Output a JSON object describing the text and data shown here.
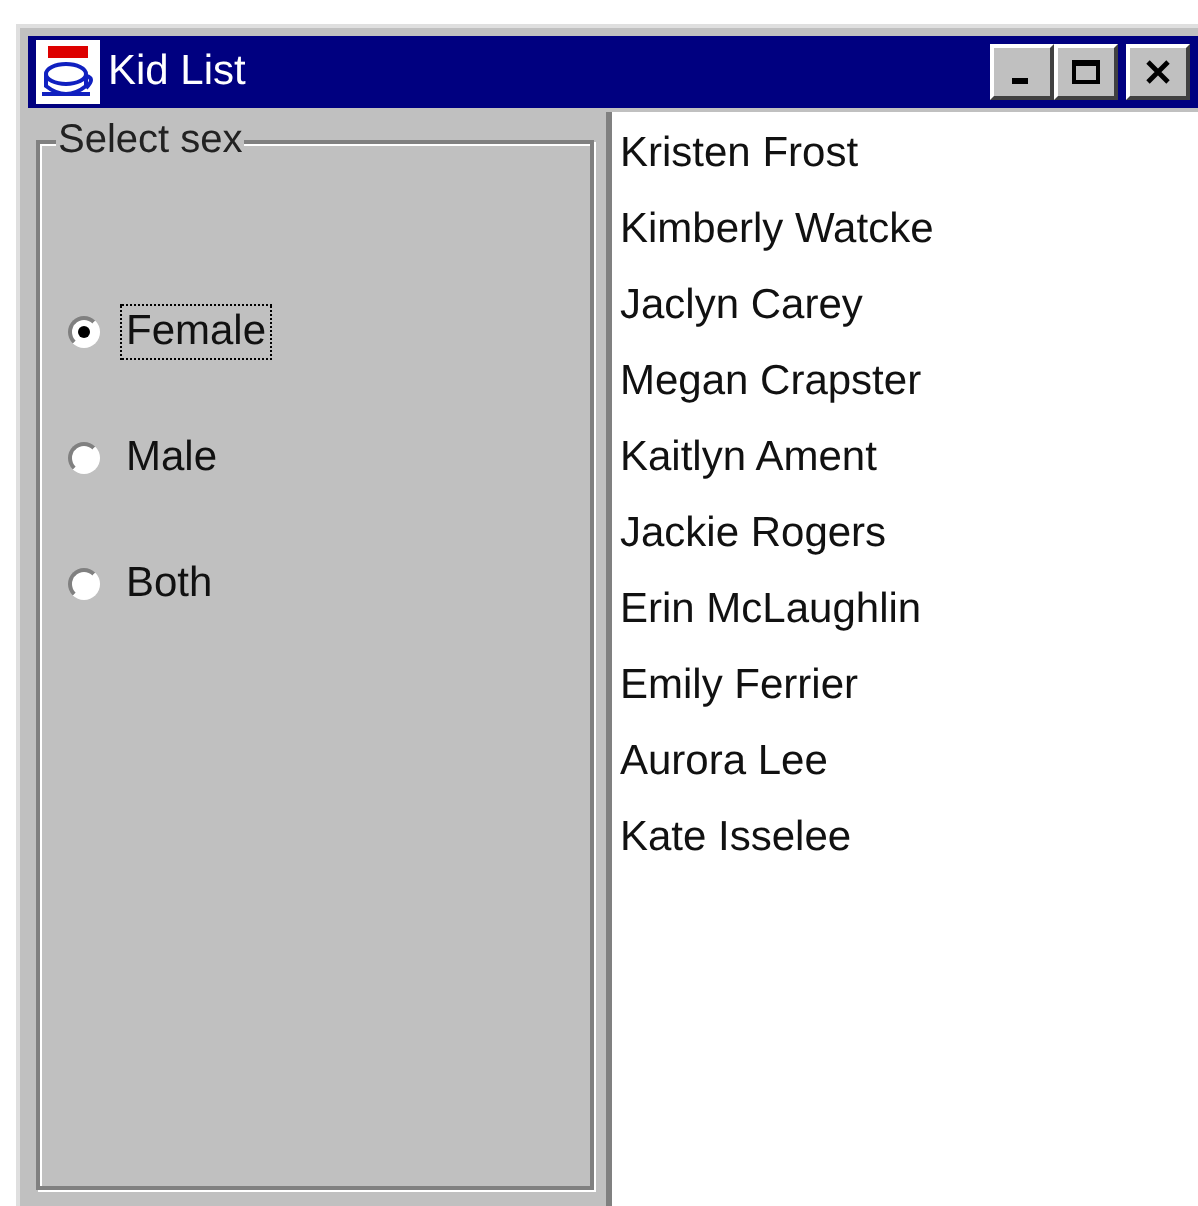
{
  "window": {
    "title": "Kid List"
  },
  "sex_group": {
    "title": "Select sex",
    "options": [
      {
        "label": "Female",
        "selected": true
      },
      {
        "label": "Male",
        "selected": false
      },
      {
        "label": "Both",
        "selected": false
      }
    ]
  },
  "kids": [
    "Kristen Frost",
    "Kimberly Watcke",
    "Jaclyn Carey",
    "Megan Crapster",
    "Kaitlyn Ament",
    "Jackie Rogers",
    "Erin McLaughlin",
    "Emily Ferrier",
    "Aurora Lee",
    "Kate Isselee"
  ]
}
